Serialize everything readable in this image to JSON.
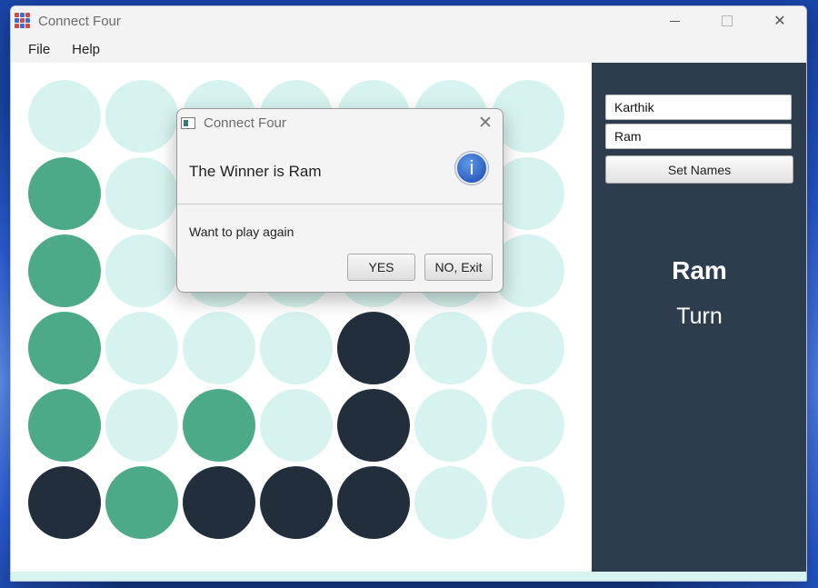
{
  "window": {
    "title": "Connect Four",
    "controls": {
      "minimize_icon": "minimize-icon",
      "maximize_icon": "maximize-icon",
      "close_glyph": "✕"
    }
  },
  "menu": {
    "items": [
      "File",
      "Help"
    ]
  },
  "board": {
    "rows": 6,
    "cols": 7,
    "colors": {
      "empty": "#d6f3ef",
      "green": "#4caa88",
      "dark": "#232e3c"
    },
    "grid": [
      [
        "empty",
        "empty",
        "empty",
        "empty",
        "empty",
        "empty",
        "empty"
      ],
      [
        "green",
        "empty",
        "empty",
        "empty",
        "empty",
        "empty",
        "empty"
      ],
      [
        "green",
        "empty",
        "empty",
        "empty",
        "empty",
        "empty",
        "empty"
      ],
      [
        "green",
        "empty",
        "empty",
        "empty",
        "dark",
        "empty",
        "empty"
      ],
      [
        "green",
        "empty",
        "green",
        "empty",
        "dark",
        "empty",
        "empty"
      ],
      [
        "dark",
        "green",
        "dark",
        "dark",
        "dark",
        "empty",
        "empty"
      ]
    ]
  },
  "side_panel": {
    "player1_value": "Karthik",
    "player2_value": "Ram",
    "set_names_label": "Set Names",
    "current_player": "Ram",
    "turn_label": "Turn"
  },
  "dialog": {
    "title": "Connect Four",
    "close_glyph": "✕",
    "header_text": "The Winner is Ram",
    "info_glyph": "i",
    "content_text": "Want to play again",
    "yes_label": "YES",
    "no_label": "NO, Exit"
  }
}
